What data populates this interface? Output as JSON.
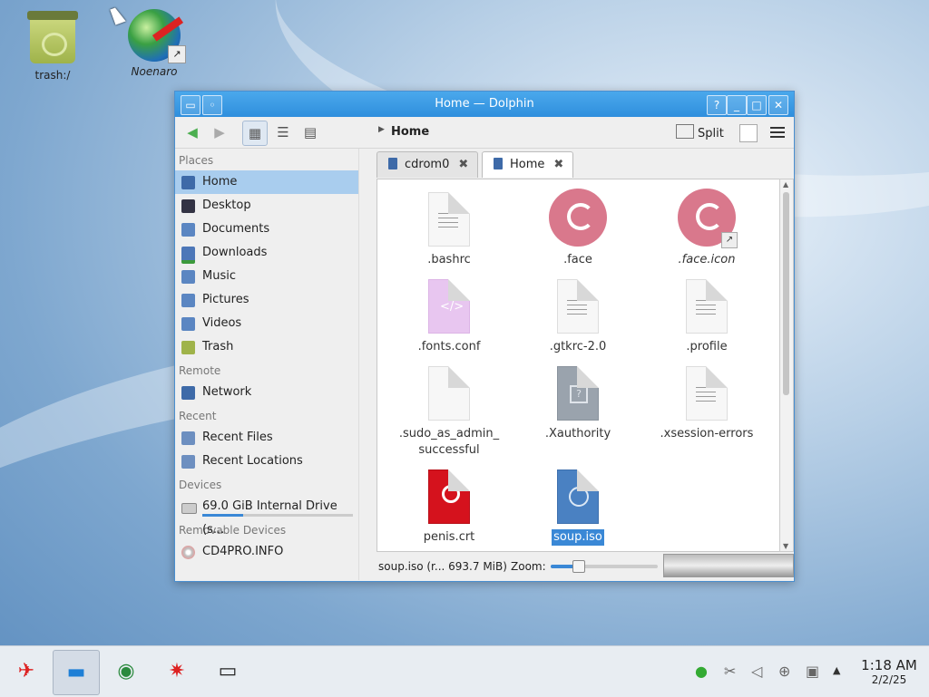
{
  "desktop": {
    "icons": [
      {
        "label": "trash:/"
      },
      {
        "label": "Noenaro"
      }
    ]
  },
  "window": {
    "title": "Home — Dolphin"
  },
  "toolbar": {
    "breadcrumb": "Home",
    "split_label": "Split"
  },
  "places": {
    "sections": {
      "places": "Places",
      "remote": "Remote",
      "recent": "Recent",
      "devices": "Devices",
      "removable": "Removable Devices"
    },
    "items": {
      "home": "Home",
      "desktop": "Desktop",
      "documents": "Documents",
      "downloads": "Downloads",
      "music": "Music",
      "pictures": "Pictures",
      "videos": "Videos",
      "trash": "Trash",
      "network": "Network",
      "recent_files": "Recent Files",
      "recent_locations": "Recent Locations",
      "internal_drive": "69.0 GiB Internal Drive (s...",
      "cd4pro": "CD4PRO.INFO"
    },
    "drive_usage": 0.27
  },
  "tabs": [
    {
      "label": "cdrom0"
    },
    {
      "label": "Home"
    }
  ],
  "files": [
    {
      "name": ".bashrc"
    },
    {
      "name": ".face"
    },
    {
      "name": ".face.icon"
    },
    {
      "name": ".fonts.conf"
    },
    {
      "name": ".gtkrc-2.0"
    },
    {
      "name": ".profile"
    },
    {
      "name": ".sudo_as_admin_\nsuccessful"
    },
    {
      "name": ".Xauthority"
    },
    {
      "name": ".xsession-errors"
    },
    {
      "name": "penis.crt"
    },
    {
      "name": "soup.iso"
    }
  ],
  "statusbar": {
    "info": "soup.iso (r... 693.7 MiB)",
    "zoom_label": "Zoom:",
    "zoom_level": 0.25
  },
  "taskbar": {
    "time": "1:18 AM",
    "date": "2/2/25"
  },
  "colors": {
    "accent": "#3a88d6",
    "titlebar": "#2f8fdd"
  }
}
